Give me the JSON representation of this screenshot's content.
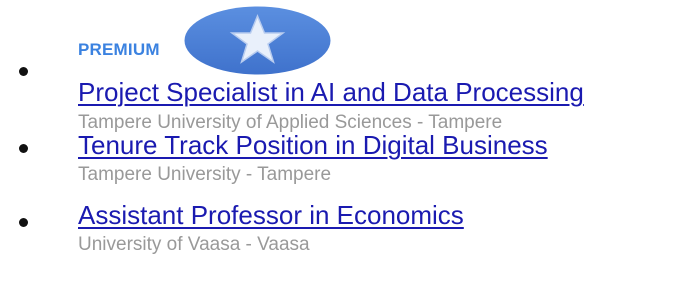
{
  "jobs": [
    {
      "premium_label": "PREMIUM",
      "title": "Project Specialist in AI and Data Processing",
      "employer_location": "Tampere University of Applied Sciences - Tampere"
    },
    {
      "title": "Tenure Track Position in Digital Business",
      "employer_location": "Tampere University - Tampere"
    },
    {
      "title": "Assistant Professor in Economics",
      "employer_location": "University of Vaasa - Vaasa"
    }
  ],
  "colors": {
    "premium": "#3b82e0",
    "link": "#1a1ab0",
    "meta": "#999999",
    "badge": "#4a7fd6"
  },
  "icons": {
    "premium_badge": "star-icon",
    "bullet": "bullet-dot"
  }
}
